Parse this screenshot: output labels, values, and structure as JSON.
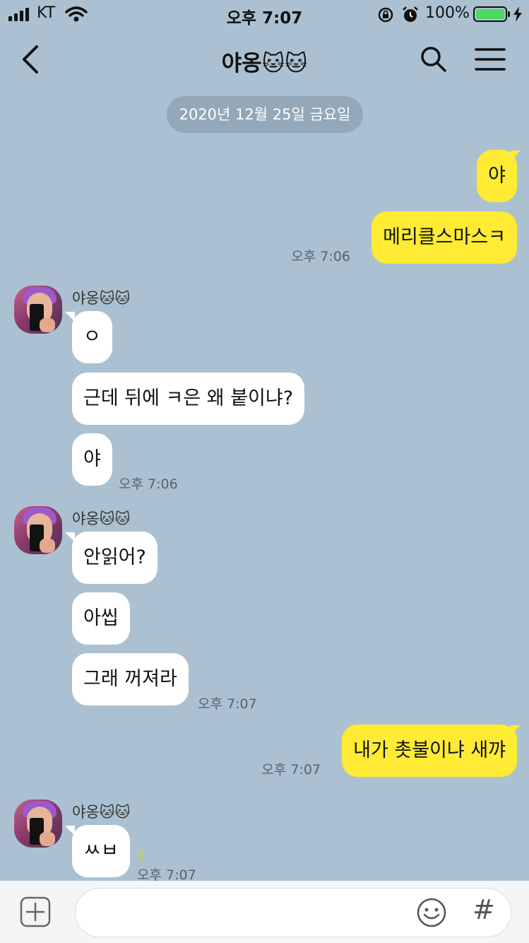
{
  "status_bar": {
    "carrier": "KT",
    "time": "오후 7:07",
    "battery_percent": "100%",
    "battery_level": 1.0,
    "battery_color": "#4cd964"
  },
  "header": {
    "title": "야옹🐱🐱"
  },
  "date_divider": "2020년 12월 25일 금요일",
  "messages": {
    "m1": "야",
    "m2": "메리클스마스ㅋ",
    "m2_time": "오후 7:06",
    "g1_sender": "야옹🐱🐱",
    "m3": "ㅇ",
    "m4": "근데 뒤에 ㅋ은 왜 붙이냐?",
    "m5": "야",
    "m5_time": "오후 7:06",
    "g2_sender": "야옹🐱🐱",
    "m6": "안읽어?",
    "m7": "아씹",
    "m8": "그래 꺼져라",
    "m8_time": "오후 7:07",
    "m9": "내가 촛불이냐 새꺄",
    "m9_time": "오후 7:07",
    "g3_sender": "야옹🐱🐱",
    "m10": "ㅆㅂ",
    "m10_unread": "1",
    "m10_time": "오후 7:07"
  },
  "colors": {
    "background": "#abc1d1",
    "my_bubble": "#ffeb33",
    "other_bubble": "#ffffff"
  },
  "input": {
    "value": ""
  },
  "icons": [
    "back-icon",
    "search-icon",
    "menu-icon",
    "plus-icon",
    "emoji-icon",
    "hash-icon",
    "wifi-icon",
    "alarm-icon",
    "rotation-lock-icon",
    "battery-icon",
    "charging-icon"
  ]
}
